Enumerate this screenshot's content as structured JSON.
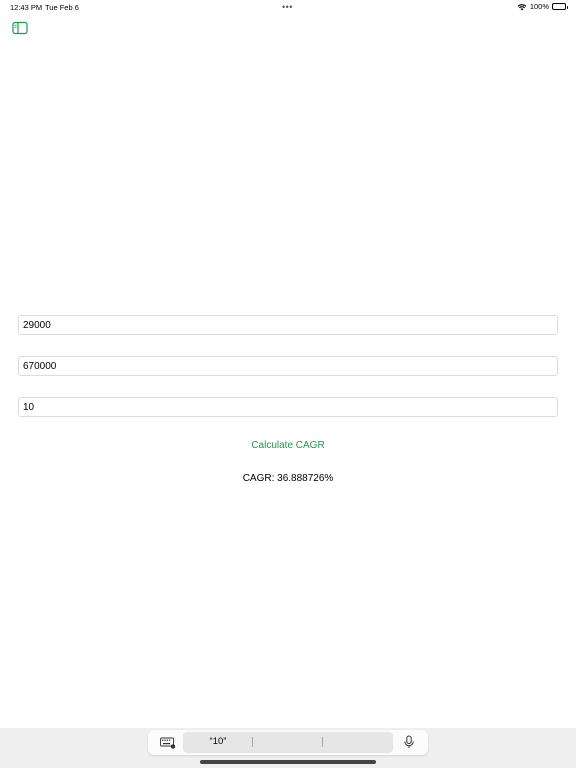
{
  "status_bar": {
    "time": "12:43 PM",
    "date": "Tue Feb 6",
    "dots": "•••",
    "battery": "100%"
  },
  "icons": {
    "sidebar_toggle": "sidebar-icon",
    "wifi": "wifi-icon",
    "battery": "battery-icon",
    "keyboard": "keyboard-icon",
    "mic": "mic-icon"
  },
  "form": {
    "initial_value": "29000",
    "final_value": "670000",
    "years": "10"
  },
  "calculate_button": "Calculate CAGR",
  "result": "CAGR: 36.888726%",
  "keyboard": {
    "suggestion": "“10”"
  },
  "colors": {
    "accent": "#1a9c4a"
  }
}
